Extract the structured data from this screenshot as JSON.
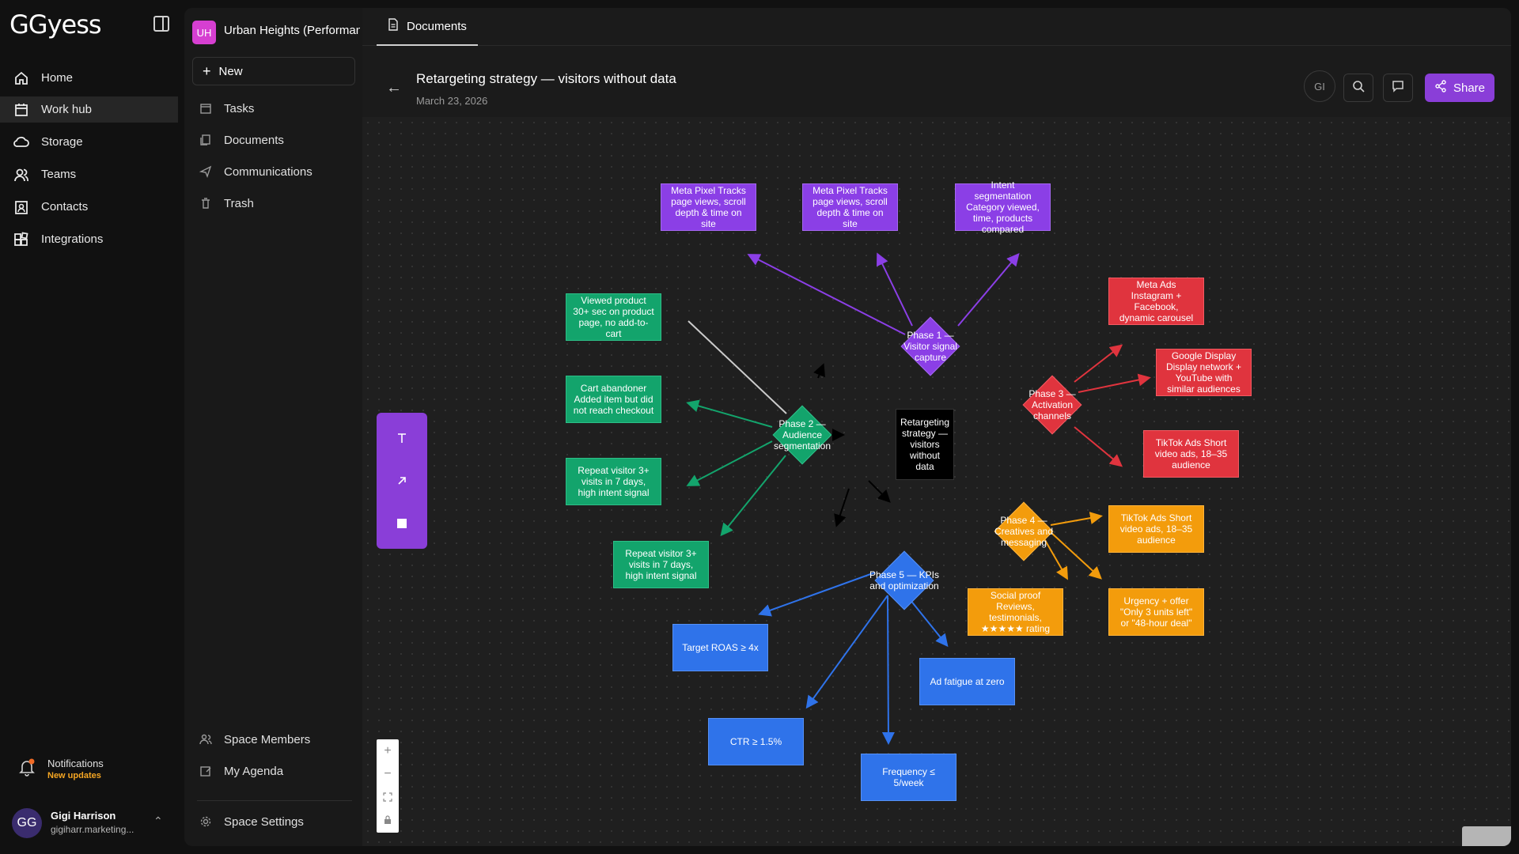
{
  "app": {
    "logo": "GGyess",
    "nav": [
      {
        "label": "Home",
        "icon": "home-icon"
      },
      {
        "label": "Work hub",
        "icon": "calendar-icon"
      },
      {
        "label": "Storage",
        "icon": "cloud-icon"
      },
      {
        "label": "Teams",
        "icon": "users-icon"
      },
      {
        "label": "Contacts",
        "icon": "contact-icon"
      },
      {
        "label": "Integrations",
        "icon": "integrations-icon"
      }
    ],
    "active_nav": "Work hub",
    "notifications": {
      "label": "Notifications",
      "sub": "New updates"
    },
    "user": {
      "initials": "GG",
      "name": "Gigi Harrison",
      "email": "gigiharr.marketing..."
    }
  },
  "panel": {
    "space_initials": "UH",
    "space_name": "Urban Heights (Performance",
    "new_label": "New",
    "items": [
      {
        "label": "Tasks",
        "icon": "tasks-icon"
      },
      {
        "label": "Documents",
        "icon": "documents-icon"
      },
      {
        "label": "Communications",
        "icon": "send-icon"
      },
      {
        "label": "Trash",
        "icon": "trash-icon"
      }
    ],
    "bottom_items": [
      {
        "label": "Space Members",
        "icon": "members-icon"
      },
      {
        "label": "My Agenda",
        "icon": "agenda-icon"
      }
    ],
    "settings_label": "Space Settings"
  },
  "main": {
    "tab": "Documents",
    "title": "Retargeting strategy — visitors without data",
    "date": "March 23, 2026",
    "collaborator_initials": "GI",
    "share_label": "Share"
  },
  "diagram": {
    "center": "Retargeting strategy — visitors without data",
    "phase1": {
      "label": "Phase 1 — Visitor signal capture",
      "nodes": [
        "Meta Pixel Tracks page views, scroll depth & time on site",
        "Meta Pixel Tracks page views, scroll depth & time on site",
        "Intent segmentation Category viewed, time, products compared"
      ]
    },
    "phase2": {
      "label": "Phase 2 — Audience segmentation",
      "nodes": [
        "Viewed product 30+ sec on product page, no add-to-cart",
        "Cart abandoner Added item but did not reach checkout",
        "Repeat visitor 3+ visits in 7 days, high intent signal",
        "Repeat visitor 3+ visits in 7 days, high intent signal"
      ]
    },
    "phase3": {
      "label": "Phase 3 — Activation channels",
      "nodes": [
        "Meta Ads Instagram + Facebook, dynamic carousel",
        "Google Display Display network + YouTube with similar audiences",
        "TikTok Ads Short video ads, 18–35 audience"
      ]
    },
    "phase4": {
      "label": "Phase 4 — Creatives and messaging",
      "nodes": [
        "TikTok Ads Short video ads, 18–35 audience",
        "Social proof Reviews, testimonials, ★★★★★ rating",
        "Urgency + offer \"Only 3 units left\" or \"48-hour deal\""
      ]
    },
    "phase5": {
      "label": "Phase 5 — KPIs and optimization",
      "nodes": [
        "Target ROAS ≥ 4x",
        "Ad fatigue at zero",
        "CTR ≥ 1.5%",
        "Frequency ≤ 5/week"
      ]
    },
    "colors": {
      "phase1": "#8b3fe6",
      "phase2": "#13a46c",
      "phase3": "#e0343e",
      "phase4": "#f39c0c",
      "phase5": "#2f73ea",
      "center": "#000000",
      "accent": "#8a3ed8"
    }
  }
}
